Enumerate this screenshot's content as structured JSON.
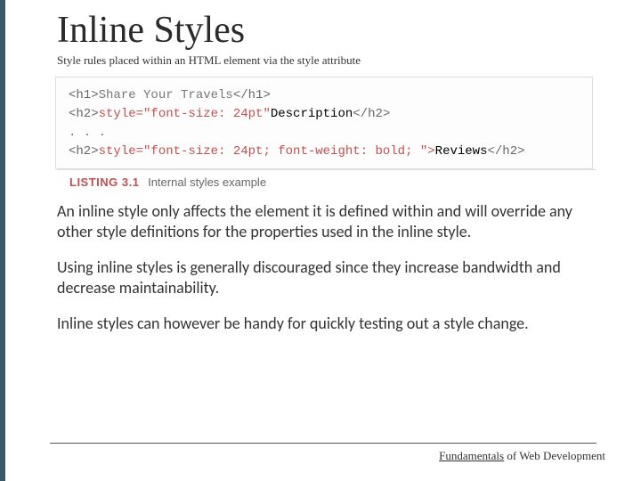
{
  "title": "Inline Styles",
  "subtitle": "Style rules placed within an HTML element via the style attribute",
  "code": {
    "l1": {
      "tagOpen": "<h1>",
      "text": "Share Your Travels",
      "tagClose": "</h1>"
    },
    "l2": {
      "tagOpen": "<h2>",
      "attr": "style=\"font-size: 24pt\"",
      "text": "Description",
      "tagClose": "</h2>"
    },
    "l3": ". . .",
    "l4": {
      "tagOpen": "<h2>",
      "attr": "style=\"font-size: 24pt; font-weight: bold; \">",
      "text": "Reviews",
      "tagClose": "</h2>"
    }
  },
  "listing": {
    "label": "LISTING 3.1",
    "desc": "Internal styles example"
  },
  "paragraphs": {
    "p1": "An inline style only affects the element it is defined within and will override any other style definitions for the properties used in the inline style.",
    "p2": "Using inline styles is generally discouraged since they increase bandwidth and decrease maintainability.",
    "p3": "Inline styles can however be handy for quickly testing out a style change."
  },
  "footer": {
    "part1": "Fundamentals",
    "part2": " of Web Development"
  }
}
